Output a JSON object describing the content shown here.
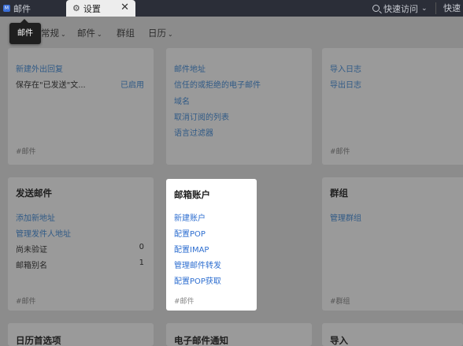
{
  "tabs": {
    "mail_logo": "M",
    "mail_label": "邮件",
    "settings_label": "设置",
    "close_glyph": "✕"
  },
  "quick_access": {
    "label": "快速访问",
    "right_label": "快速"
  },
  "tooltip": {
    "text": "邮件"
  },
  "nav": {
    "general": "常规",
    "mail": "邮件",
    "group": "群组",
    "calendar": "日历"
  },
  "cards": {
    "top_left": {
      "links": [
        "新建外出回复"
      ],
      "saved_label": "保存在\"已发送\"文...",
      "saved_status": "已启用",
      "tag": "#邮件"
    },
    "top_mid": {
      "links": [
        "邮件地址",
        "信任的或拒绝的电子邮件",
        "域名",
        "取消订阅的列表",
        "语言过滤器"
      ]
    },
    "top_right": {
      "links": [
        "导入日志",
        "导出日志"
      ],
      "tag": "#邮件"
    },
    "send_mail": {
      "title": "发送邮件",
      "links": [
        "添加新地址",
        "管理发件人地址"
      ],
      "rows": [
        {
          "label": "尚未验证",
          "value": "0"
        },
        {
          "label": "邮箱别名",
          "value": "1"
        }
      ],
      "tag": "#邮件"
    },
    "mailbox_account": {
      "title": "邮箱账户",
      "links": [
        "新建账户",
        "配置POP",
        "配置IMAP",
        "管理邮件转发",
        "配置POP获取"
      ],
      "tag": "#邮件"
    },
    "groups": {
      "title": "群组",
      "links": [
        "管理群组"
      ],
      "tag": "#群组"
    },
    "calendar_prefs": {
      "title": "日历首选项"
    },
    "email_notify": {
      "title": "电子邮件通知"
    },
    "import": {
      "title": "导入"
    }
  }
}
